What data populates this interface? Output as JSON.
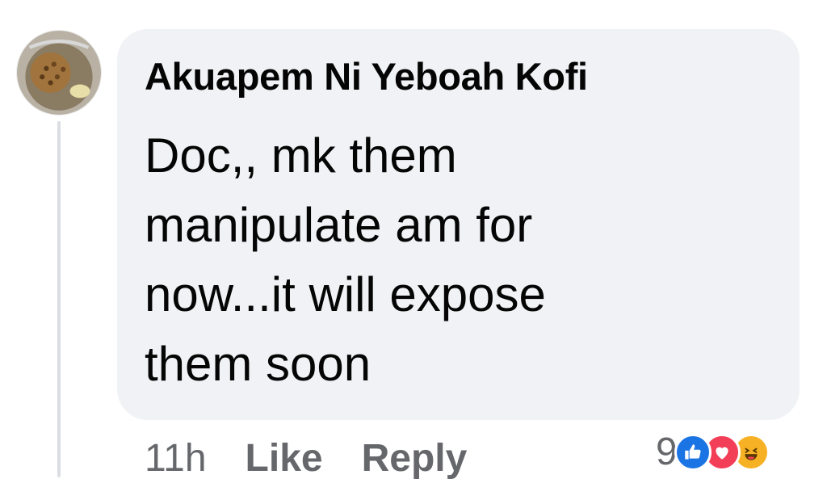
{
  "comment": {
    "author": "Akuapem Ni Yeboah Kofi",
    "text_lines": [
      "Doc,, mk them",
      "manipulate am for",
      "now...it will expose",
      "them soon"
    ],
    "timestamp": "11h",
    "like_label": "Like",
    "reply_label": "Reply",
    "reaction_count": "9",
    "reactions": [
      "like-icon",
      "love-icon",
      "haha-icon"
    ]
  },
  "colors": {
    "bubble_bg": "#f0f2f5",
    "text": "#050505",
    "meta_text": "#65676b",
    "like_blue": "#1b74e4",
    "love_red": "#f33e58",
    "haha_yellow": "#f7b125"
  }
}
